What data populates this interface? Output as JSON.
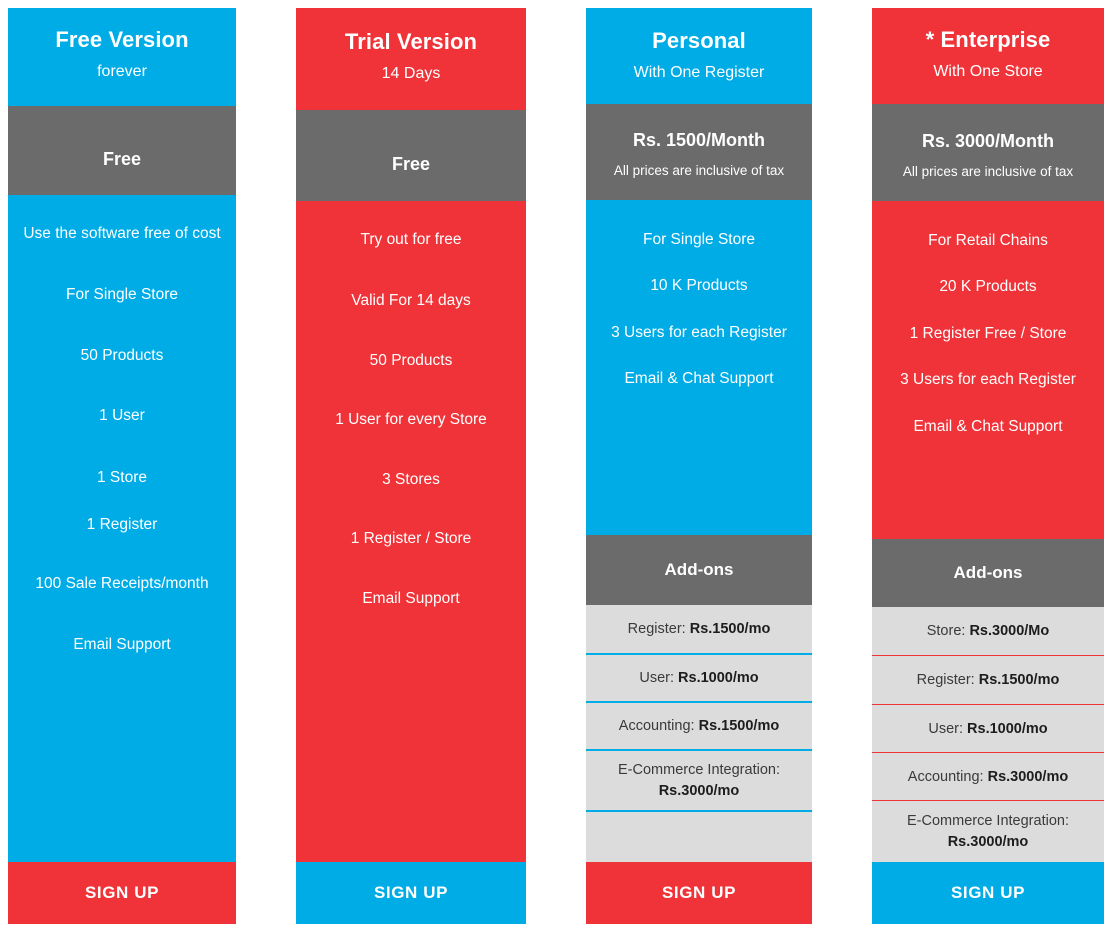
{
  "plans": [
    {
      "name": "Free Version",
      "subtitle": "forever",
      "header_color": "#00ace6",
      "price_main": "Free",
      "price_note": "",
      "features": [
        "Use the software free of cost",
        "For Single Store",
        "50 Products",
        "1 User",
        "1 Store",
        "1 Register",
        "100 Sale Receipts/month",
        "Email Support"
      ],
      "addons_title": "",
      "addons": [],
      "signup_label": "SIGN UP",
      "signup_color": "#ef3338"
    },
    {
      "name": "Trial Version",
      "subtitle": "14 Days",
      "header_color": "#ef3338",
      "price_main": "Free",
      "price_note": "",
      "features": [
        "Try out for free",
        "Valid For 14 days",
        "50 Products",
        "1 User for every Store",
        "3 Stores",
        "1 Register / Store",
        "Email Support"
      ],
      "addons_title": "",
      "addons": [],
      "signup_label": "SIGN UP",
      "signup_color": "#00ace6"
    },
    {
      "name": "Personal",
      "subtitle": "With One Register",
      "header_color": "#00ace6",
      "price_main": "Rs. 1500/Month",
      "price_note": "All prices are inclusive of tax",
      "features": [
        "For Single Store",
        "10 K Products",
        "3 Users for each Register",
        "Email & Chat Support"
      ],
      "addons_title": "Add-ons",
      "addons": [
        {
          "label": "Register:",
          "price": "Rs.1500/mo",
          "stacked": false
        },
        {
          "label": "User:",
          "price": "Rs.1000/mo",
          "stacked": false
        },
        {
          "label": "Accounting:",
          "price": "Rs.1500/mo",
          "stacked": false
        },
        {
          "label": "E-Commerce Integration:",
          "price": "Rs.3000/mo",
          "stacked": true
        },
        {
          "label": "",
          "price": "",
          "stacked": false
        }
      ],
      "signup_label": "SIGN UP",
      "signup_color": "#ef3338"
    },
    {
      "name": "* Enterprise",
      "subtitle": "With One Store",
      "header_color": "#ef3338",
      "price_main": "Rs. 3000/Month",
      "price_note": "All prices are inclusive of tax",
      "features": [
        "For Retail Chains",
        "20 K Products",
        "1 Register Free / Store",
        "3 Users for each Register",
        "Email & Chat Support"
      ],
      "addons_title": "Add-ons",
      "addons": [
        {
          "label": "Store:",
          "price": "Rs.3000/Mo",
          "stacked": false
        },
        {
          "label": "Register:",
          "price": "Rs.1500/mo",
          "stacked": false
        },
        {
          "label": "User:",
          "price": "Rs.1000/mo",
          "stacked": false
        },
        {
          "label": "Accounting:",
          "price": "Rs.3000/mo",
          "stacked": false
        },
        {
          "label": "E-Commerce Integration:",
          "price": "Rs.3000/mo",
          "stacked": true
        }
      ],
      "signup_label": "SIGN UP",
      "signup_color": "#00ace6"
    }
  ],
  "colors": {
    "blue": "#00ace6",
    "red": "#ef3338",
    "gray_band": "#6b6b6b",
    "addon_bg": "#dcdcdc",
    "white": "#ffffff"
  }
}
